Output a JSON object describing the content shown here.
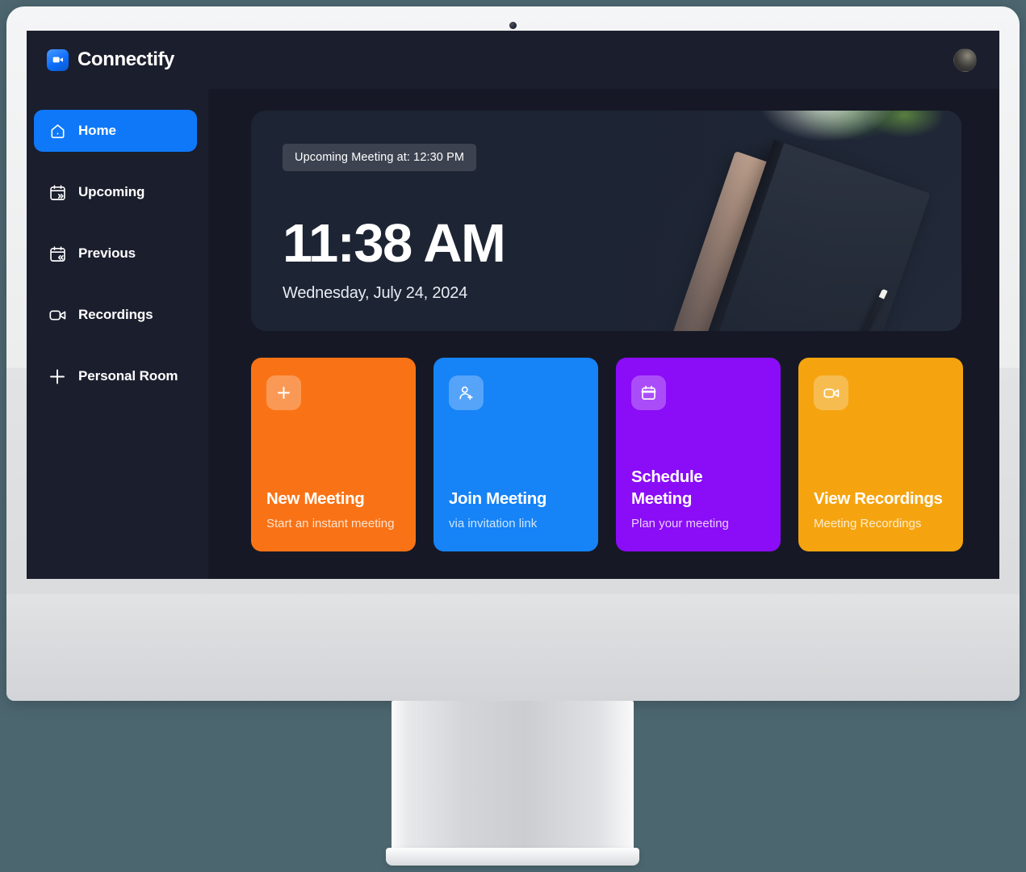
{
  "device": {
    "type": "desktop-monitor",
    "webcam_icon": "camera-dot-icon",
    "background_color": "#4c6670",
    "bezel_color": "#ececed",
    "stand_color": "#d3d5d8"
  },
  "app": {
    "brand_name": "Connectify",
    "brand_logo_icon": "video-camera-logo-icon",
    "screen_bg": "#161925",
    "sidebar_bg": "#1b1e2d",
    "accent_color": "#0e78f9",
    "avatar_icon": "user-avatar-icon"
  },
  "sidebar": {
    "items": [
      {
        "label": "Home",
        "icon": "home-icon",
        "active": true
      },
      {
        "label": "Upcoming",
        "icon": "calendar-forward-icon",
        "active": false
      },
      {
        "label": "Previous",
        "icon": "calendar-back-icon",
        "active": false
      },
      {
        "label": "Recordings",
        "icon": "video-camera-icon",
        "active": false
      },
      {
        "label": "Personal Room",
        "icon": "plus-icon",
        "active": false
      }
    ]
  },
  "hero": {
    "badge": "Upcoming Meeting at: 12:30 PM",
    "time": "11:38 AM",
    "date": "Wednesday, July 24, 2024",
    "image_description": "desk-photo-notebook-pencil-plant"
  },
  "cards": [
    {
      "title": "New Meeting",
      "subtitle": "Start an instant meeting",
      "icon": "plus-icon",
      "color": "#f97316"
    },
    {
      "title": "Join Meeting",
      "subtitle": "via invitation link",
      "icon": "person-add-icon",
      "color": "#1683f7"
    },
    {
      "title": "Schedule Meeting",
      "subtitle": "Plan your meeting",
      "icon": "calendar-icon",
      "color": "#8b0cf7"
    },
    {
      "title": "View Recordings",
      "subtitle": "Meeting Recordings",
      "icon": "video-camera-icon",
      "color": "#f5a410"
    }
  ]
}
